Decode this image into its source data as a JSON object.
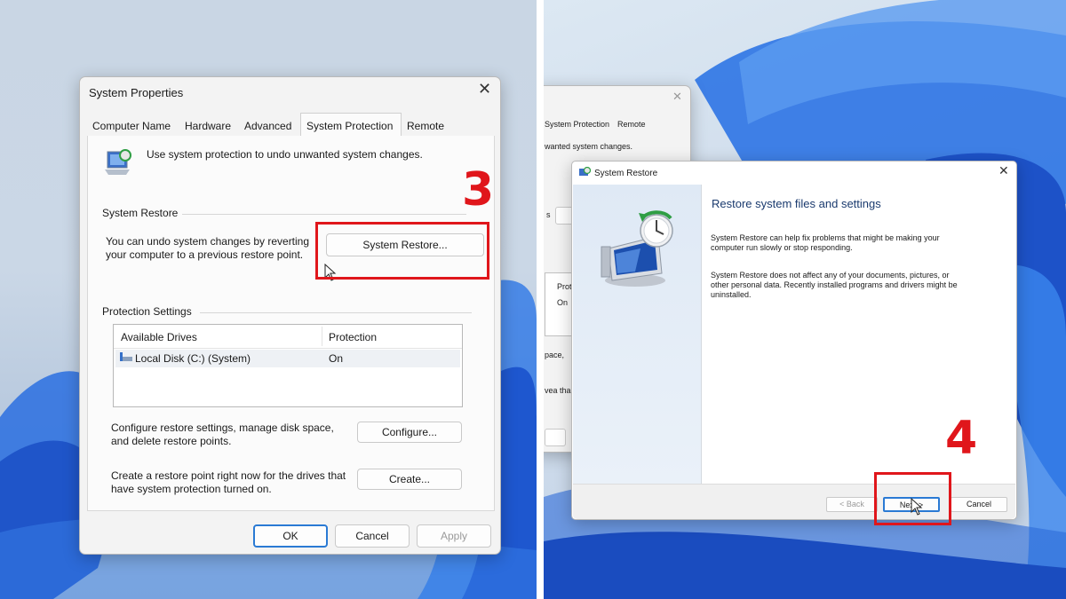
{
  "left": {
    "dialog_title": "System Properties",
    "tabs": [
      "Computer Name",
      "Hardware",
      "Advanced",
      "System Protection",
      "Remote"
    ],
    "intro_text": "Use system protection to undo unwanted system changes.",
    "system_restore_group": "System Restore",
    "restore_desc_line1": "You can undo system changes by reverting",
    "restore_desc_line2": "your computer to a previous restore point.",
    "system_restore_button": "System Restore...",
    "protection_group": "Protection Settings",
    "table_headers": [
      "Available Drives",
      "Protection"
    ],
    "table_rows": [
      {
        "drive": "Local Disk (C:) (System)",
        "protection": "On"
      }
    ],
    "configure_desc_line1": "Configure restore settings, manage disk space,",
    "configure_desc_line2": "and delete restore points.",
    "configure_button": "Configure...",
    "create_desc_line1": "Create a restore point right now for the drives that",
    "create_desc_line2": "have system protection turned on.",
    "create_button": "Create...",
    "ok_button": "OK",
    "cancel_button": "Cancel",
    "apply_button": "Apply",
    "step_number": "3"
  },
  "right": {
    "bg_tab_1": "System Protection",
    "bg_tab_2": "Remote",
    "bg_text_1": "wanted system changes.",
    "bg_label_prot": "Prot",
    "bg_label_on": "On",
    "bg_text_space": "pace,",
    "bg_text_area": "vea tha",
    "bg_text_s": "s",
    "dialog_title": "System Restore",
    "heading": "Restore system files and settings",
    "para1_line1": "System Restore can help fix problems that might be making your",
    "para1_line2": "computer run slowly or stop responding.",
    "para2_line1": "System Restore does not affect any of your documents, pictures, or",
    "para2_line2": "other personal data. Recently installed programs and drivers might be",
    "para2_line3": "uninstalled.",
    "back_button": "< Back",
    "next_button": "Next >",
    "cancel_button": "Cancel",
    "step_number": "4"
  },
  "colors": {
    "highlight": "#e0161b",
    "accent": "#0067c0",
    "wallpaper": "#1f5fd6"
  }
}
